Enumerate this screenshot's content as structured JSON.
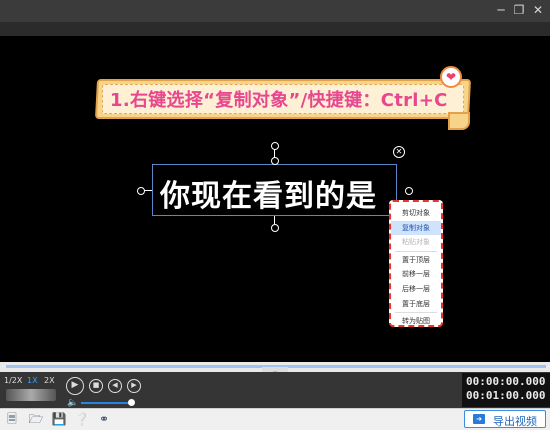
{
  "window": {
    "minimize_icon": "minimize-icon",
    "restore_icon": "restore-icon",
    "close_icon": "close-icon"
  },
  "canvas": {
    "banner_text": "1.右键选择“复制对象”/快捷键：Ctrl+C",
    "selected_text": "你现在看到的是"
  },
  "context_menu": {
    "items": [
      {
        "label": "剪切对象",
        "state": "normal"
      },
      {
        "label": "复制对象",
        "state": "highlighted"
      },
      {
        "label": "粘贴对象",
        "state": "disabled"
      },
      {
        "label": "置于顶层",
        "state": "normal"
      },
      {
        "label": "前移一层",
        "state": "normal"
      },
      {
        "label": "后移一层",
        "state": "normal"
      },
      {
        "label": "置于底层",
        "state": "normal"
      },
      {
        "label": "转为贴图",
        "state": "normal"
      }
    ]
  },
  "player": {
    "speeds": [
      "1/2X",
      "1X",
      "2X"
    ],
    "active_speed": "1X",
    "current_time": "00:00:00.000",
    "total_time": "00:01:00.000"
  },
  "toolbar": {
    "export_label": "导出视频"
  },
  "colors": {
    "banner_text": "#e8468e",
    "accent": "#2a7ad9",
    "menu_border": "#ee3333"
  }
}
